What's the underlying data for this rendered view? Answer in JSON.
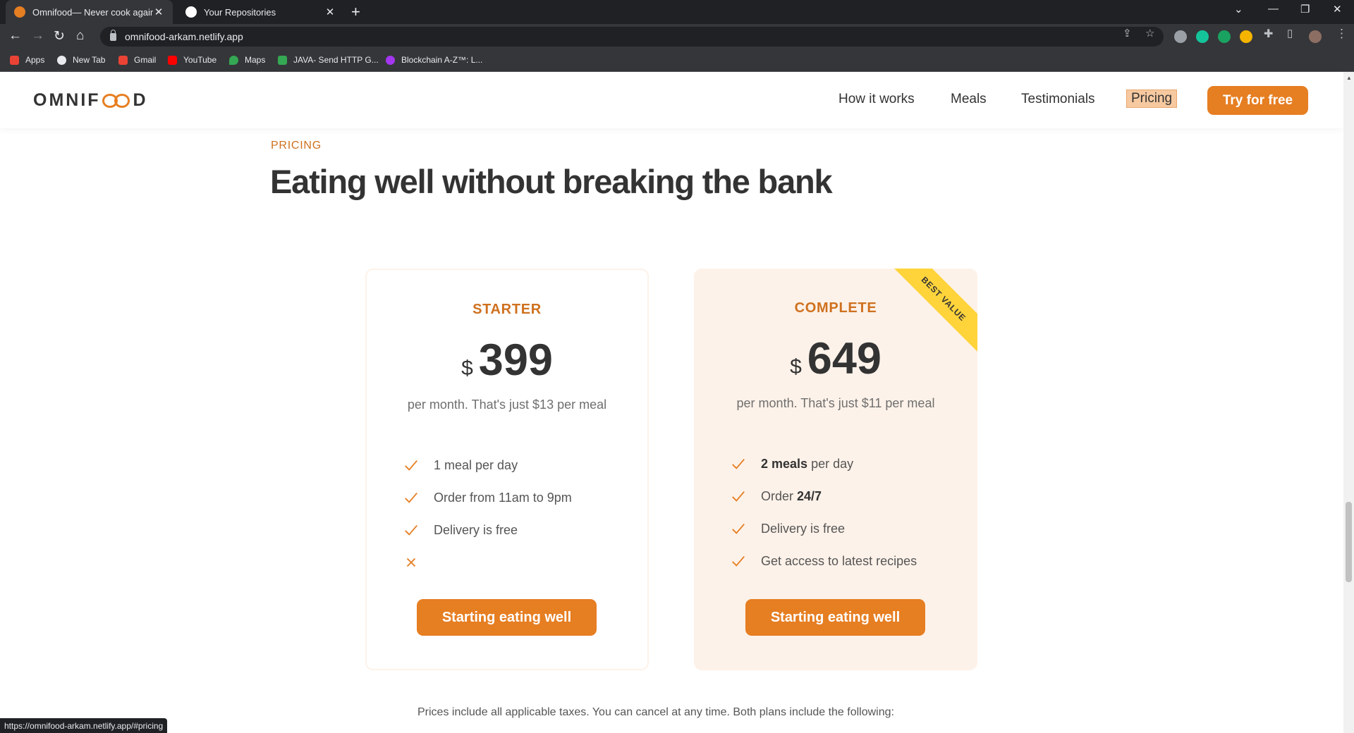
{
  "browser": {
    "tabs": [
      {
        "title": "Omnifood— Never cook again",
        "active": true
      },
      {
        "title": "Your Repositories",
        "active": false
      }
    ],
    "url": "omnifood-arkam.netlify.app",
    "status_url": "https://omnifood-arkam.netlify.app/#pricing",
    "bookmarks": [
      "Apps",
      "New Tab",
      "Gmail",
      "YouTube",
      "Maps",
      "JAVA- Send HTTP G...",
      "Blockchain A-Z™: L..."
    ]
  },
  "site": {
    "logo": {
      "before": "OMNIF",
      "after": "D"
    },
    "nav": [
      "How it works",
      "Meals",
      "Testimonials",
      "Pricing"
    ],
    "nav_active": "Pricing",
    "cta": "Try for free"
  },
  "section": {
    "subheading": "PRICING",
    "heading": "Eating well without breaking the bank"
  },
  "plans": [
    {
      "name": "STARTER",
      "currency": "$",
      "price": "399",
      "per": "per month. That's just $13 per meal",
      "features": [
        {
          "text": "1 meal per day",
          "icon": "checkmark-icon"
        },
        {
          "text": "Order from 11am to 9pm",
          "icon": "checkmark-icon"
        },
        {
          "text": "Delivery is free",
          "icon": "checkmark-icon"
        },
        {
          "text": "",
          "icon": "close-icon"
        }
      ],
      "button": "Starting eating well"
    },
    {
      "name": "COMPLETE",
      "currency": "$",
      "price": "649",
      "per": "per month. That's just $11 per meal",
      "badge": "BEST VALUE",
      "features": [
        {
          "strong": "2 meals",
          "text": " per day",
          "icon": "checkmark-icon"
        },
        {
          "text": "Order ",
          "strong": "24/7",
          "icon": "checkmark-icon"
        },
        {
          "text": "Delivery is free",
          "icon": "checkmark-icon"
        },
        {
          "text": "Get access to latest recipes",
          "icon": "checkmark-icon"
        }
      ],
      "button": "Starting eating well"
    }
  ],
  "plan_note": "Prices include all applicable taxes. You can cancel at any time. Both plans include the following:",
  "colors": {
    "accent": "#e67e22",
    "accent_dark": "#cf711f",
    "tint": "#fdf2e9",
    "ribbon": "#ffd43b"
  }
}
